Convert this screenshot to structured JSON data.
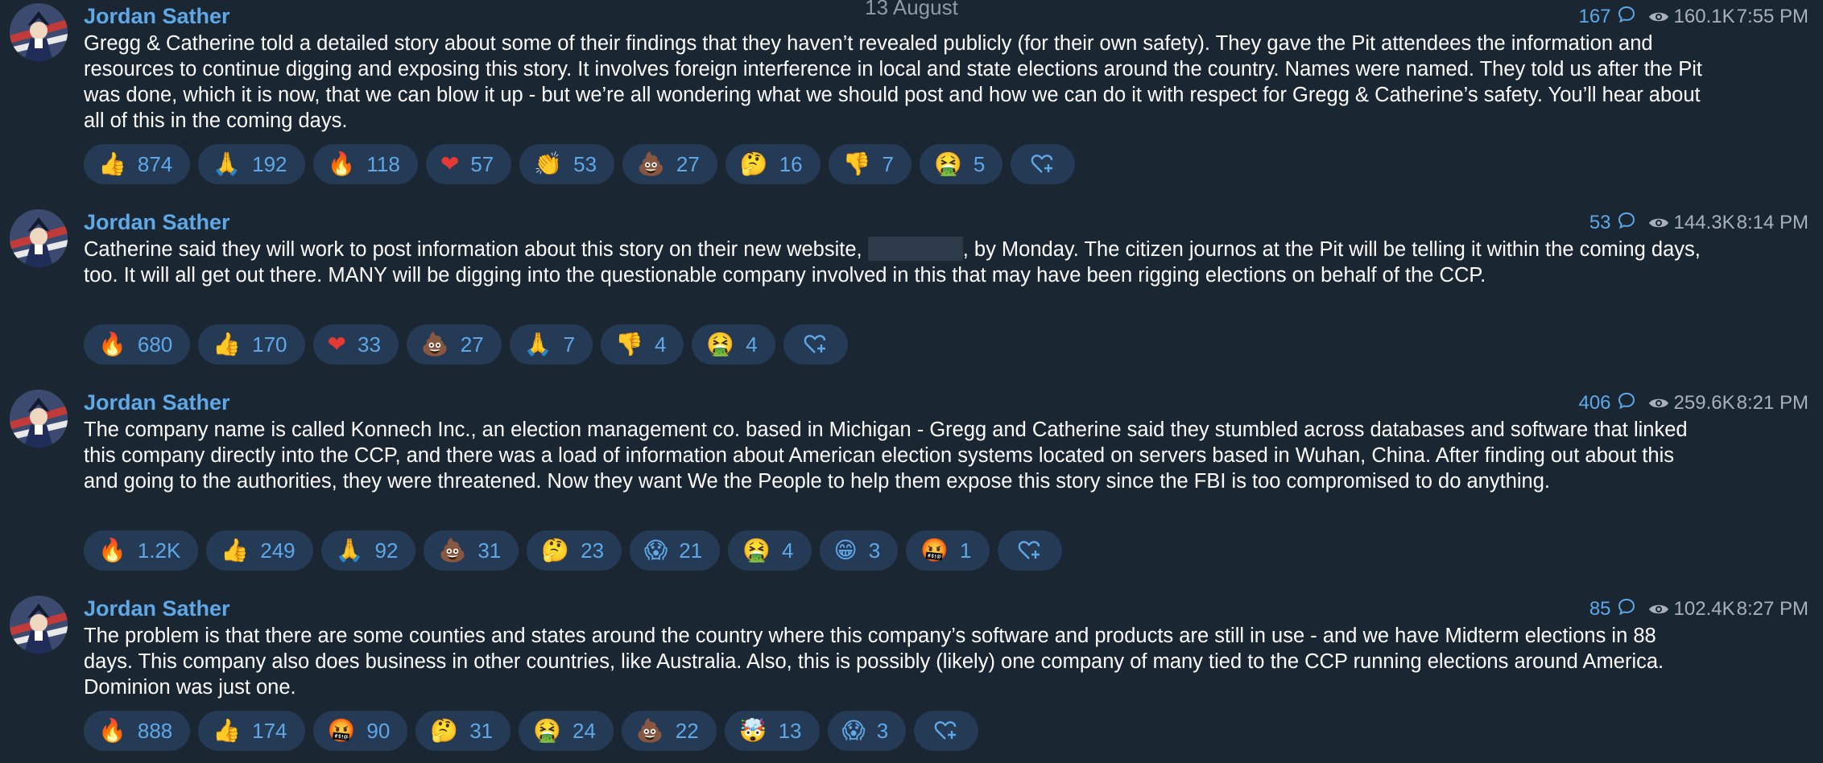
{
  "date_separator": "13 August",
  "colors": {
    "background": "#1b2633",
    "accent": "#5fa8e8",
    "reaction_bg": "#243a55",
    "muted": "#a8b1bb"
  },
  "messages": [
    {
      "author": "Jordan Sather",
      "replies": "167",
      "views": "160.1K",
      "time": "7:55 PM",
      "text": "Gregg & Catherine told a detailed story about some of their findings that they haven’t revealed publicly (for their own safety). They gave the Pit attendees the information and resources to continue digging and exposing this story. It involves foreign interference in local and state elections around the country. Names were named. They told us after the Pit was done, which it is now, that we can blow it up - but we’re all wondering what we should post and how we can do it with respect for Gregg & Catherine’s safety. You’ll hear about all of this in the coming days.",
      "reactions": [
        {
          "emoji": "👍",
          "icon": "thumbs-up-icon",
          "count": "874"
        },
        {
          "emoji": "🙏",
          "icon": "folded-hands-icon",
          "count": "192"
        },
        {
          "emoji": "🔥",
          "icon": "fire-icon",
          "count": "118"
        },
        {
          "emoji": "❤",
          "icon": "heart-icon",
          "count": "57"
        },
        {
          "emoji": "👏",
          "icon": "clapping-hands-icon",
          "count": "53"
        },
        {
          "emoji": "💩",
          "icon": "poo-icon",
          "count": "27"
        },
        {
          "emoji": "🤔",
          "icon": "thinking-face-icon",
          "count": "16"
        },
        {
          "emoji": "👎",
          "icon": "thumbs-down-icon",
          "count": "7"
        },
        {
          "emoji": "🤮",
          "icon": "vomiting-face-icon",
          "count": "5"
        }
      ]
    },
    {
      "author": "Jordan Sather",
      "replies": "53",
      "views": "144.3K",
      "time": "8:14 PM",
      "text_before": "Catherine said they will work to post information about this story on their new website, ",
      "text_after": ", by Monday. The citizen journos at the Pit will be telling it within the coming days, too. It will all get out there. MANY will be digging into the questionable company involved in this that may have been rigging elections on behalf of the CCP.",
      "reactions": [
        {
          "emoji": "🔥",
          "icon": "fire-icon",
          "count": "680"
        },
        {
          "emoji": "👍",
          "icon": "thumbs-up-icon",
          "count": "170"
        },
        {
          "emoji": "❤",
          "icon": "heart-icon",
          "count": "33"
        },
        {
          "emoji": "💩",
          "icon": "poo-icon",
          "count": "27"
        },
        {
          "emoji": "🙏",
          "icon": "folded-hands-icon",
          "count": "7"
        },
        {
          "emoji": "👎",
          "icon": "thumbs-down-icon",
          "count": "4"
        },
        {
          "emoji": "🤮",
          "icon": "vomiting-face-icon",
          "count": "4"
        }
      ]
    },
    {
      "author": "Jordan Sather",
      "replies": "406",
      "views": "259.6K",
      "time": "8:21 PM",
      "text": "The company name is called Konnech Inc., an election management co. based in Michigan - Gregg and Catherine said they stumbled across databases and software that linked this company directly into the CCP, and there was a load of information about American election systems located on servers based in Wuhan, China. After finding out about this and going to the authorities, they were threatened. Now they want We the People to help them expose this story since the FBI is too compromised to do anything.",
      "reactions": [
        {
          "emoji": "🔥",
          "icon": "fire-icon",
          "count": "1.2K"
        },
        {
          "emoji": "👍",
          "icon": "thumbs-up-icon",
          "count": "249"
        },
        {
          "emoji": "🙏",
          "icon": "folded-hands-icon",
          "count": "92"
        },
        {
          "emoji": "💩",
          "icon": "poo-icon",
          "count": "31"
        },
        {
          "emoji": "🤔",
          "icon": "thinking-face-icon",
          "count": "23"
        },
        {
          "emoji": "😱",
          "icon": "screaming-face-icon",
          "count": "21"
        },
        {
          "emoji": "🤮",
          "icon": "vomiting-face-icon",
          "count": "4"
        },
        {
          "emoji": "😁",
          "icon": "grinning-face-icon",
          "count": "3"
        },
        {
          "emoji": "🤬",
          "icon": "cursing-face-icon",
          "count": "1"
        }
      ]
    },
    {
      "author": "Jordan Sather",
      "replies": "85",
      "views": "102.4K",
      "time": "8:27 PM",
      "text": "The problem is that there are some counties and states around the country where this company’s software and products are still in use - and we have Midterm elections in 88 days. This company also does business in other countries, like Australia. Also, this is possibly (likely) one company of many tied to the CCP running elections around America. Dominion was just one.",
      "reactions": [
        {
          "emoji": "🔥",
          "icon": "fire-icon",
          "count": "888"
        },
        {
          "emoji": "👍",
          "icon": "thumbs-up-icon",
          "count": "174"
        },
        {
          "emoji": "🤬",
          "icon": "cursing-face-icon",
          "count": "90"
        },
        {
          "emoji": "🤔",
          "icon": "thinking-face-icon",
          "count": "31"
        },
        {
          "emoji": "🤮",
          "icon": "vomiting-face-icon",
          "count": "24"
        },
        {
          "emoji": "💩",
          "icon": "poo-icon",
          "count": "22"
        },
        {
          "emoji": "🤯",
          "icon": "exploding-head-icon",
          "count": "13"
        },
        {
          "emoji": "😱",
          "icon": "screaming-face-icon",
          "count": "3"
        }
      ]
    }
  ]
}
